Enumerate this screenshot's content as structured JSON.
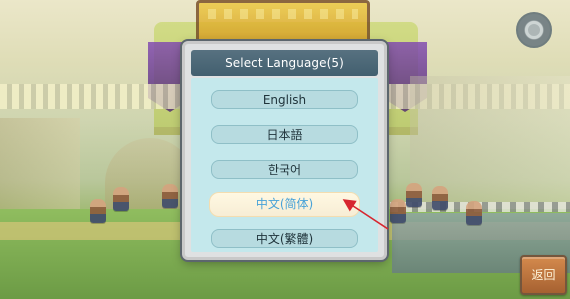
{
  "dialog": {
    "title": "Select Language(5)",
    "options": [
      {
        "label": "English",
        "selected": false
      },
      {
        "label": "日本語",
        "selected": false
      },
      {
        "label": "한국어",
        "selected": false
      },
      {
        "label": "中文(简体)",
        "selected": true
      },
      {
        "label": "中文(繁體)",
        "selected": false
      }
    ]
  },
  "controls": {
    "return_label": "返回"
  },
  "colors": {
    "dialog_header": "#4b6675",
    "dialog_body": "#c4e8ec",
    "option_background": "#b7dbe0",
    "selected_background": "#fff8e2",
    "selected_text": "#47a2d8",
    "annotation_arrow": "#d7262f",
    "return_button": "#bd7440"
  }
}
